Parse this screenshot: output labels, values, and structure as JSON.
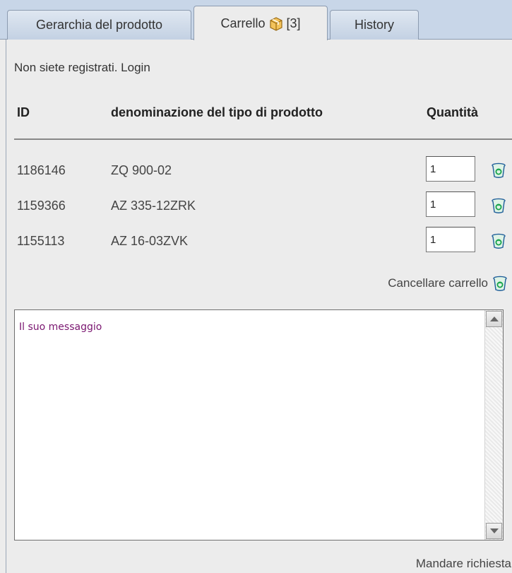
{
  "tabs": [
    {
      "label": "Gerarchia del prodotto"
    },
    {
      "label": "Carrello",
      "count": "[3]"
    },
    {
      "label": "History"
    }
  ],
  "notice": "Non siete registrati. Login",
  "table": {
    "headers": {
      "id": "ID",
      "name": "denominazione del tipo di prodotto",
      "qty": "Quantità"
    },
    "rows": [
      {
        "id": "1186146",
        "name": "ZQ 900-02",
        "qty": "1"
      },
      {
        "id": "1159366",
        "name": "AZ 335-12ZRK",
        "qty": "1"
      },
      {
        "id": "1155113",
        "name": "AZ 16-03ZVK",
        "qty": "1"
      }
    ]
  },
  "clear_cart_label": "Cancellare carrello",
  "message": {
    "text": "Il suo messaggio"
  },
  "send_label": "Mandare richiesta",
  "icons": {
    "tab_cart": "cart-box-icon",
    "row_delete": "trash-icon",
    "clear_cart": "trash-icon"
  },
  "colors": {
    "tabbar": "#c8d6e8",
    "panel": "#ececec",
    "trash_green": "#17a34a",
    "trash_blue": "#1f5e99",
    "message_text": "#7a1670"
  }
}
